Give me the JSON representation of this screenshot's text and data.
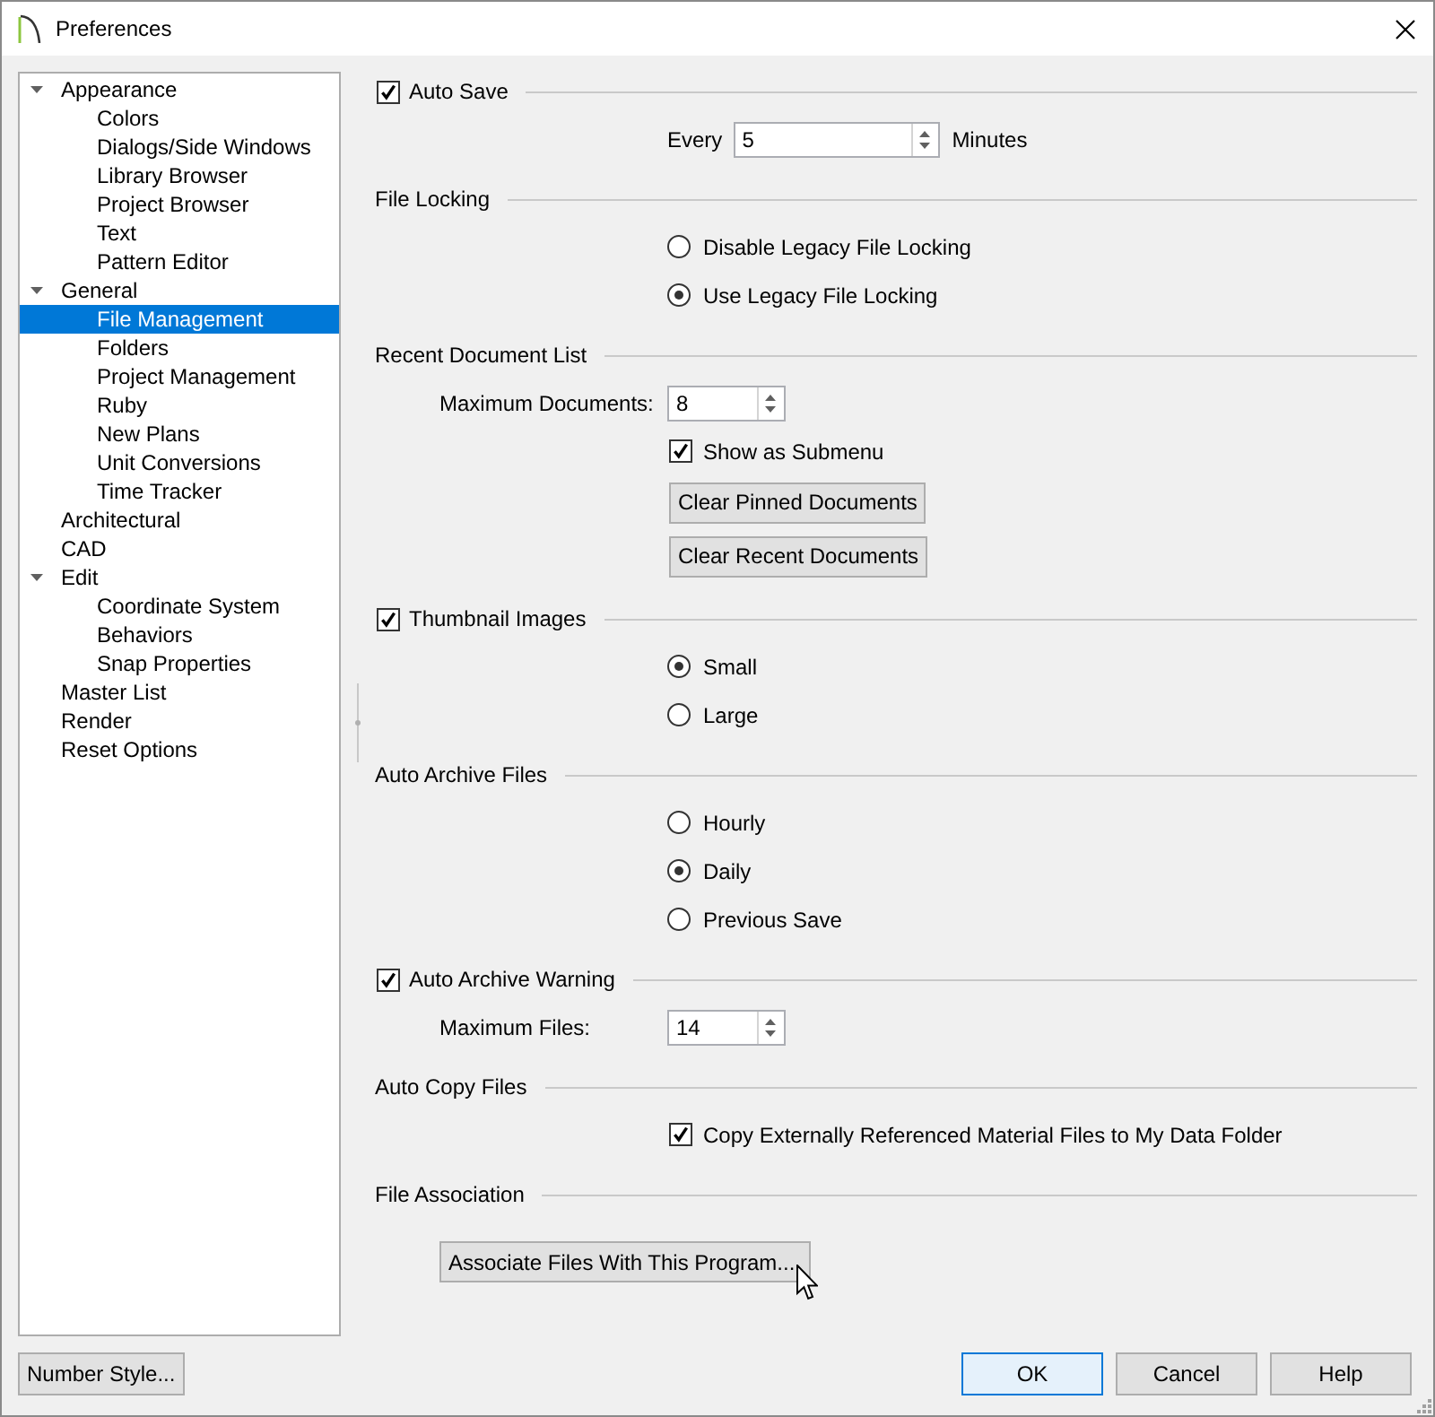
{
  "window": {
    "title": "Preferences"
  },
  "sidebar": {
    "items": [
      {
        "label": "Appearance",
        "expanded": true,
        "selected": false,
        "children": [
          {
            "label": "Colors",
            "selected": false
          },
          {
            "label": "Dialogs/Side Windows",
            "selected": false
          },
          {
            "label": "Library Browser",
            "selected": false
          },
          {
            "label": "Project Browser",
            "selected": false
          },
          {
            "label": "Text",
            "selected": false
          },
          {
            "label": "Pattern Editor",
            "selected": false
          }
        ]
      },
      {
        "label": "General",
        "expanded": true,
        "selected": false,
        "children": [
          {
            "label": "File Management",
            "selected": true
          },
          {
            "label": "Folders",
            "selected": false
          },
          {
            "label": "Project Management",
            "selected": false
          },
          {
            "label": "Ruby",
            "selected": false
          },
          {
            "label": "New Plans",
            "selected": false
          },
          {
            "label": "Unit Conversions",
            "selected": false
          },
          {
            "label": "Time Tracker",
            "selected": false
          }
        ]
      },
      {
        "label": "Architectural",
        "selected": false
      },
      {
        "label": "CAD",
        "selected": false
      },
      {
        "label": "Edit",
        "expanded": true,
        "selected": false,
        "children": [
          {
            "label": "Coordinate System",
            "selected": false
          },
          {
            "label": "Behaviors",
            "selected": false
          },
          {
            "label": "Snap Properties",
            "selected": false
          }
        ]
      },
      {
        "label": "Master List",
        "selected": false
      },
      {
        "label": "Render",
        "selected": false
      },
      {
        "label": "Reset Options",
        "selected": false
      }
    ]
  },
  "sections": [
    {
      "kind": "check",
      "title": "Auto Save",
      "checked": true,
      "rows": [
        {
          "kind": "interval",
          "label": "Every",
          "value": "5",
          "suffix": "Minutes"
        }
      ]
    },
    {
      "kind": "plain",
      "title": "File Locking",
      "rows": [
        {
          "kind": "radio",
          "label": "Disable Legacy File Locking",
          "selected": false
        },
        {
          "kind": "radio",
          "label": "Use Legacy File Locking",
          "selected": true
        }
      ]
    },
    {
      "kind": "plain",
      "title": "Recent Document List",
      "rows": [
        {
          "kind": "spin",
          "label": "Maximum Documents:",
          "value": "8"
        },
        {
          "kind": "checkbox",
          "label": "Show as Submenu",
          "checked": true
        },
        {
          "kind": "button",
          "label": "Clear Pinned Documents"
        },
        {
          "kind": "button",
          "label": "Clear Recent Documents"
        }
      ]
    },
    {
      "kind": "check",
      "title": "Thumbnail Images",
      "checked": true,
      "rows": [
        {
          "kind": "radio",
          "label": "Small",
          "selected": true
        },
        {
          "kind": "radio",
          "label": "Large",
          "selected": false
        }
      ]
    },
    {
      "kind": "plain",
      "title": "Auto Archive Files",
      "rows": [
        {
          "kind": "radio",
          "label": "Hourly",
          "selected": false
        },
        {
          "kind": "radio",
          "label": "Daily",
          "selected": true
        },
        {
          "kind": "radio",
          "label": "Previous Save",
          "selected": false
        }
      ]
    },
    {
      "kind": "check",
      "title": "Auto Archive Warning",
      "checked": true,
      "rows": [
        {
          "kind": "spin",
          "label": "Maximum Files:",
          "value": "14"
        }
      ]
    },
    {
      "kind": "plain",
      "title": "Auto Copy Files",
      "rows": [
        {
          "kind": "checkbox",
          "label": "Copy Externally Referenced Material Files to My Data Folder",
          "checked": true
        }
      ]
    },
    {
      "kind": "plain",
      "title": "File Association",
      "rows": [
        {
          "kind": "action",
          "label": "Associate Files With This Program..."
        }
      ]
    }
  ],
  "footer": {
    "left_buttons": [
      {
        "label": "Number Style...",
        "default": false
      }
    ],
    "right_buttons": [
      {
        "label": "OK",
        "default": true
      },
      {
        "label": "Cancel",
        "default": false
      },
      {
        "label": "Help",
        "default": false
      }
    ]
  }
}
